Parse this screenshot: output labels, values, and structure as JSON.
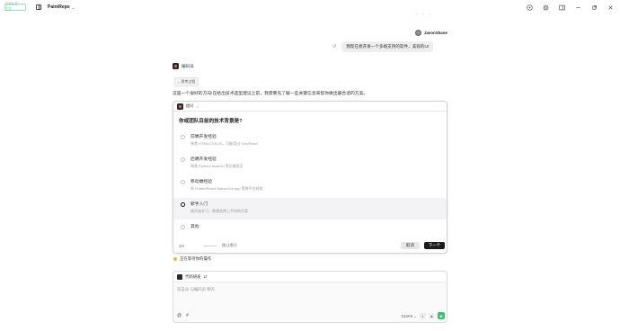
{
  "app": {
    "logo_text": "SOLO ID",
    "repo_name": "PaintRepo",
    "accent_color": "#39c26e"
  },
  "top_icons": [
    "help-icon",
    "settings-icon",
    "window-layout-icon",
    "minimize-icon",
    "maximize-icon",
    "close-icon"
  ],
  "conversation": {
    "user": {
      "name": "JasonShane",
      "message": "我现在想开发一个多端支持的软件，美观的UI"
    },
    "bot": {
      "name": "编码员",
      "thought_label": "思考过程",
      "intro": "这是一个很好的方向!在给出技术选型建议之前，我需要先了解一些关键信息来帮你做出最合适的方案。"
    }
  },
  "question_card": {
    "tab_label": "提问",
    "question": "你或团队目前的技术背景是?",
    "options": [
      {
        "title": "前端开发经验",
        "desc": "熟悉 HTML/CSS/JS，可能用过 Vue/React",
        "selected": false
      },
      {
        "title": "后端开发经验",
        "desc": "熟悉 Python/Java/Go 等后端语言",
        "selected": false
      },
      {
        "title": "移动端经验",
        "desc": "有 Flutter/React Native/Uni-app 等跨平台经验",
        "selected": false
      },
      {
        "title": "新手入门",
        "desc": "刚开始学习，希望选择上手快的方案",
        "selected": true
      },
      {
        "title": "其他",
        "desc": "",
        "selected": false
      }
    ],
    "step": "1/4",
    "skip_label": "跳过提问",
    "cancel_label": "取消",
    "next_label": "下一个"
  },
  "status": {
    "waiting_text": "正在等待你的操作"
  },
  "composer": {
    "agent_name": "代码研发",
    "placeholder": "双击@ 与编码员 聊天",
    "model": "GLM-5"
  }
}
